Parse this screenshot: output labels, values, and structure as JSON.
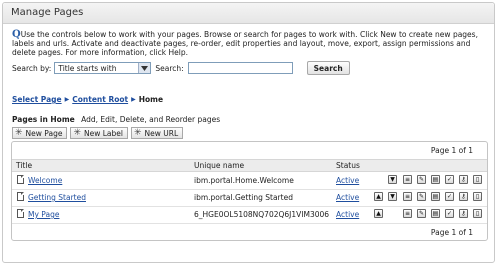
{
  "portlet": {
    "title": "Manage Pages"
  },
  "intro": {
    "q_glyph": "Q",
    "text": "Use the controls below to work with your pages. Browse or search for pages to work with. Click New to create new pages, labels and urls. Activate and deactivate pages, re-order, edit properties and layout, move, export, assign permissions and delete pages. For more information, click Help."
  },
  "search": {
    "by_label": "Search by:",
    "by_value": "Title starts with",
    "label": "Search:",
    "input_value": "",
    "button": "Search"
  },
  "breadcrumb": {
    "items": [
      "Select Page",
      "Content Root"
    ],
    "current": "Home"
  },
  "section": {
    "heading": "Pages in Home",
    "hint": "Add, Edit, Delete, and Reorder pages"
  },
  "toolbar": {
    "new_page": "New Page",
    "new_label": "New Label",
    "new_url": "New URL"
  },
  "table": {
    "pager": "Page 1 of 1",
    "columns": {
      "title": "Title",
      "unique": "Unique name",
      "status": "Status"
    },
    "rows": [
      {
        "title": "Welcome",
        "unique": "ibm.portal.Home.Welcome",
        "status": "Active"
      },
      {
        "title": "Getting Started",
        "unique": "ibm.portal.Getting Started",
        "status": "Active"
      },
      {
        "title": "My Page",
        "unique": "6_HGE0OL5108NQ702Q6J1VIM3006",
        "status": "Active"
      }
    ]
  },
  "icons": [
    "star-icon",
    "page-icon",
    "move-down-icon",
    "move-up-icon",
    "properties-icon",
    "edit-icon",
    "layout-icon",
    "move-icon",
    "permissions-icon",
    "delete-icon",
    "dropdown-arrow-icon"
  ]
}
